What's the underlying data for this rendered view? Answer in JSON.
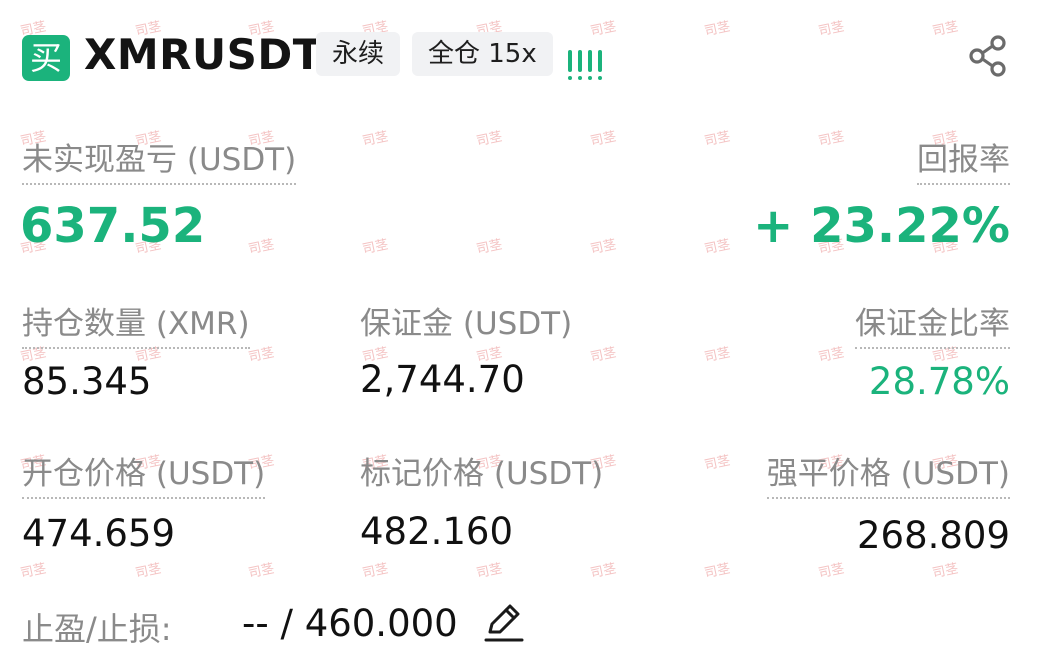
{
  "header": {
    "side_badge": "买",
    "symbol": "XMRUSDT",
    "contract_type": "永续",
    "margin_mode": "全仓 15x",
    "share_icon": "share-icon",
    "strength_icon": "signal-bars-icon"
  },
  "pnl": {
    "label": "未实现盈亏 (USDT)",
    "value": "637.52",
    "roe_label": "回报率",
    "roe_value": "+ 23.22%"
  },
  "stats": {
    "size_label": "持仓数量 (XMR)",
    "size_value": "85.345",
    "margin_label": "保证金 (USDT)",
    "margin_value": "2,744.70",
    "margin_ratio_label": "保证金比率",
    "margin_ratio_value": "28.78%",
    "entry_label": "开仓价格 (USDT)",
    "entry_value": "474.659",
    "mark_label": "标记价格 (USDT)",
    "mark_value": "482.160",
    "liq_label": "强平价格 (USDT)",
    "liq_value": "268.809"
  },
  "tpsl": {
    "label": "止盈/止损:",
    "value": "-- / 460.000",
    "edit_icon": "pencil-icon"
  },
  "watermark": "司茎",
  "colors": {
    "green": "#1bb37c",
    "label_gray": "#8a8a8a",
    "tag_bg": "#f1f2f4"
  }
}
